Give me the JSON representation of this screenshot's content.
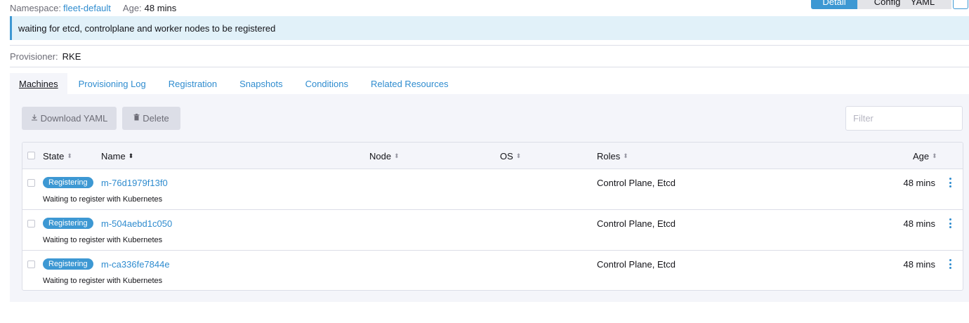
{
  "meta": {
    "namespace_label": "Namespace:",
    "namespace_value": "fleet-default",
    "age_label": "Age:",
    "age_value": "48 mins"
  },
  "view_buttons": [
    "Detail",
    "Config",
    "YAML"
  ],
  "banner": {
    "message": "waiting for etcd, controlplane and worker nodes to be registered"
  },
  "provisioner": {
    "label": "Provisioner:",
    "value": "RKE"
  },
  "tabs": [
    {
      "label": "Machines",
      "active": true
    },
    {
      "label": "Provisioning Log",
      "active": false
    },
    {
      "label": "Registration",
      "active": false
    },
    {
      "label": "Snapshots",
      "active": false
    },
    {
      "label": "Conditions",
      "active": false
    },
    {
      "label": "Related Resources",
      "active": false
    }
  ],
  "toolbar": {
    "download_label": "Download YAML",
    "download_icon": "download-icon",
    "delete_label": "Delete",
    "delete_icon": "trash-icon"
  },
  "filter": {
    "placeholder": "Filter",
    "value": ""
  },
  "table": {
    "columns": [
      "State",
      "Name",
      "Node",
      "OS",
      "Roles",
      "Age"
    ],
    "rows": [
      {
        "state": "Registering",
        "name": "m-76d1979f13f0",
        "node": "",
        "os": "",
        "roles": "Control Plane, Etcd",
        "age": "48 mins",
        "description": "Waiting to register with Kubernetes"
      },
      {
        "state": "Registering",
        "name": "m-504aebd1c050",
        "node": "",
        "os": "",
        "roles": "Control Plane, Etcd",
        "age": "48 mins",
        "description": "Waiting to register with Kubernetes"
      },
      {
        "state": "Registering",
        "name": "m-ca336fe7844e",
        "node": "",
        "os": "",
        "roles": "Control Plane, Etcd",
        "age": "48 mins",
        "description": "Waiting to register with Kubernetes"
      }
    ]
  },
  "colors": {
    "accent": "#3d98d3",
    "link": "#2f8ccf",
    "banner_bg": "#e1f1f9",
    "panel_bg": "#f4f5fa"
  }
}
